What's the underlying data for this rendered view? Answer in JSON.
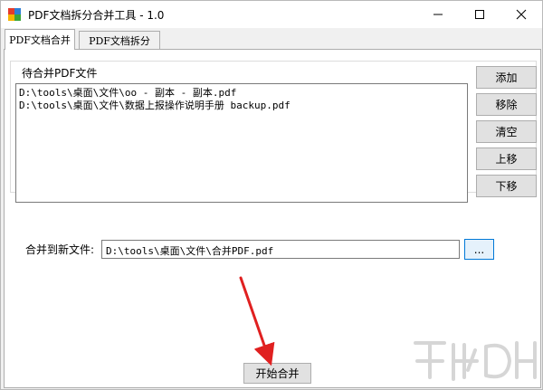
{
  "window": {
    "title": "PDF文档拆分合并工具 - 1.0",
    "controls": {
      "minimize": "minimize-icon",
      "maximize": "maximize-icon",
      "close": "close-icon"
    }
  },
  "tabs": [
    {
      "label": "PDF文档合并",
      "active": true
    },
    {
      "label": "PDF文档拆分",
      "active": false
    }
  ],
  "merge_panel": {
    "group_label": "待合并PDF文件",
    "files": [
      "D:\\tools\\桌面\\文件\\oo - 副本 - 副本.pdf",
      "D:\\tools\\桌面\\文件\\数据上报操作说明手册 backup.pdf"
    ],
    "buttons": {
      "add": "添加",
      "remove": "移除",
      "clear": "清空",
      "move_up": "上移",
      "move_down": "下移"
    },
    "output_label": "合并到新文件:",
    "output_path": "D:\\tools\\桌面\\文件\\合并PDF.pdf",
    "browse": "...",
    "start": "开始合并"
  },
  "colors": {
    "annotation_arrow": "#e02020",
    "focus_border": "#0078d7"
  }
}
